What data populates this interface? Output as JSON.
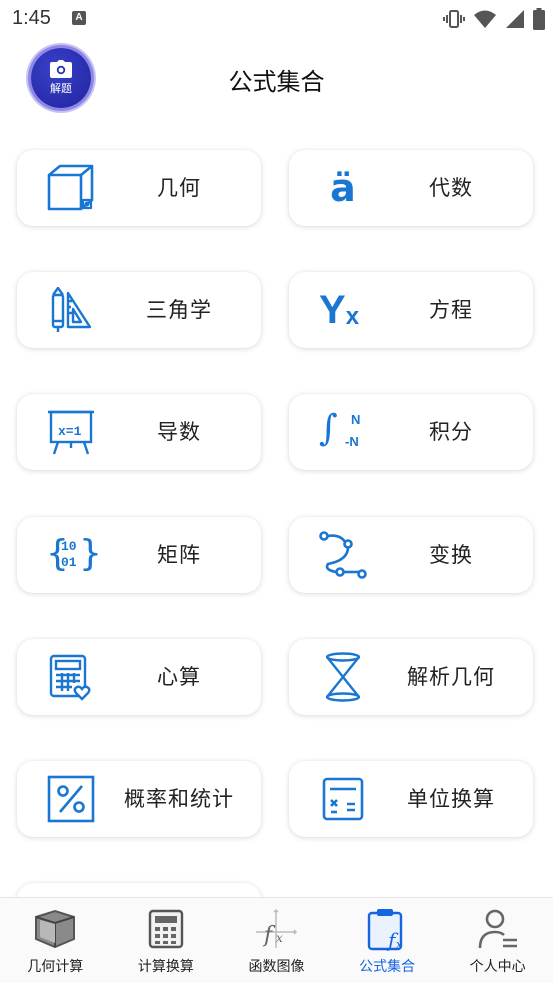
{
  "status_bar": {
    "time": "1:45",
    "notification_letter": "A"
  },
  "header": {
    "title": "公式集合",
    "scan_button_label": "解题"
  },
  "categories": [
    {
      "label": "几何",
      "icon": "cube-icon"
    },
    {
      "label": "代数",
      "icon": "a-umlaut-icon"
    },
    {
      "label": "三角学",
      "icon": "pencil-triangle-icon"
    },
    {
      "label": "方程",
      "icon": "yx-icon"
    },
    {
      "label": "导数",
      "icon": "easel-board-icon"
    },
    {
      "label": "积分",
      "icon": "integral-icon"
    },
    {
      "label": "矩阵",
      "icon": "matrix-icon"
    },
    {
      "label": "变换",
      "icon": "path-transform-icon"
    },
    {
      "label": "心算",
      "icon": "calculator-heart-icon"
    },
    {
      "label": "解析几何",
      "icon": "hourglass-cone-icon"
    },
    {
      "label": "概率和统计",
      "icon": "percent-icon"
    },
    {
      "label": "单位换算",
      "icon": "calculator-icon"
    }
  ],
  "matrix_icon_text": {
    "top": "10",
    "bottom": "01"
  },
  "integral_icon_text": {
    "top": "N",
    "bottom": "-N"
  },
  "derivative_icon_text": "x=1",
  "equation_icon_text": {
    "main": "Y",
    "sub": "x"
  },
  "algebra_icon_text": "ä",
  "bottom_nav": [
    {
      "label": "几何计算",
      "icon": "box-3d-icon",
      "active": false
    },
    {
      "label": "计算换算",
      "icon": "calculator-grid-icon",
      "active": false
    },
    {
      "label": "函数图像",
      "icon": "function-graph-icon",
      "active": false
    },
    {
      "label": "公式集合",
      "icon": "clipboard-formula-icon",
      "active": true
    },
    {
      "label": "个人中心",
      "icon": "person-icon",
      "active": false
    }
  ],
  "colors": {
    "accent": "#1565e0",
    "icon_blue": "#1976d2",
    "scan_button": "#2a2fb5"
  }
}
